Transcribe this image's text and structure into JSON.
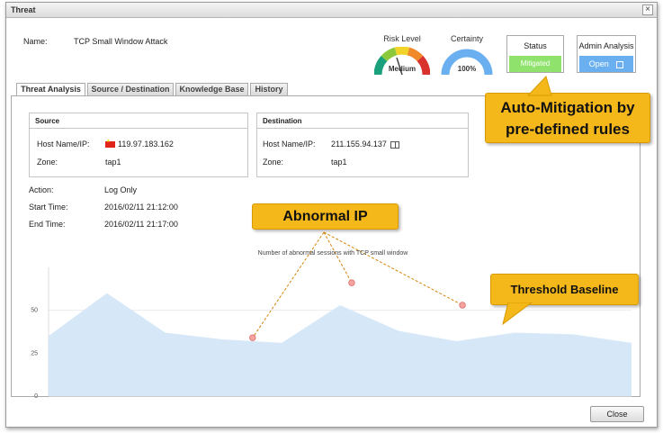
{
  "window": {
    "title": "Threat"
  },
  "threat": {
    "name_label": "Name:",
    "name_value": "TCP Small Window Attack"
  },
  "gauges": {
    "risk": {
      "label": "Risk Level",
      "value": "Medium"
    },
    "certainty": {
      "label": "Certainty",
      "value": "100%",
      "level": 1.0
    }
  },
  "status": {
    "label": "Status",
    "value": "Mitigated",
    "color": "#8fe36d"
  },
  "admin": {
    "label": "Admin Analysis",
    "value": "Open"
  },
  "tabs": [
    {
      "label": "Threat Analysis",
      "active": true
    },
    {
      "label": "Source / Destination",
      "active": false
    },
    {
      "label": "Knowledge Base",
      "active": false
    },
    {
      "label": "History",
      "active": false
    }
  ],
  "source": {
    "header": "Source",
    "host_label": "Host Name/IP:",
    "host_value": "119.97.183.162",
    "zone_label": "Zone:",
    "zone_value": "tap1",
    "flag_icon": "china-flag-icon"
  },
  "destination": {
    "header": "Destination",
    "host_label": "Host Name/IP:",
    "host_value": "211.155.94.137",
    "zone_label": "Zone:",
    "zone_value": "tap1"
  },
  "details": {
    "action_label": "Action:",
    "action_value": "Log Only",
    "start_label": "Start Time:",
    "start_value": "2016/02/11 21:12:00",
    "end_label": "End Time:",
    "end_value": "2016/02/11 21:17:00"
  },
  "chart_data": {
    "type": "area",
    "title": "Number of abnormal sessions with TCP small window",
    "xlabel": "",
    "ylabel": "",
    "ylim": [
      0,
      75
    ],
    "yticks": [
      0,
      25,
      50
    ],
    "grid": true,
    "baseline": [
      35,
      60,
      37,
      33,
      31,
      53,
      38,
      32,
      37,
      36,
      31
    ],
    "points": [
      {
        "x": 3.5,
        "y": 34
      },
      {
        "x": 5.2,
        "y": 66
      },
      {
        "x": 7.1,
        "y": 53
      }
    ],
    "colors": {
      "area": "#d6e8f8",
      "point": "#f3a3a0",
      "point_stroke": "#e06a66",
      "leader": "#d6860a"
    }
  },
  "annotations": {
    "auto_mitigation": "Auto-Mitigation by pre-defined rules",
    "abnormal_ip": "Abnormal IP",
    "threshold": "Threshold Baseline"
  },
  "footer": {
    "close_label": "Close"
  },
  "colors": {
    "callout": "#f5b81b",
    "admin_blue": "#6ab0f0"
  }
}
